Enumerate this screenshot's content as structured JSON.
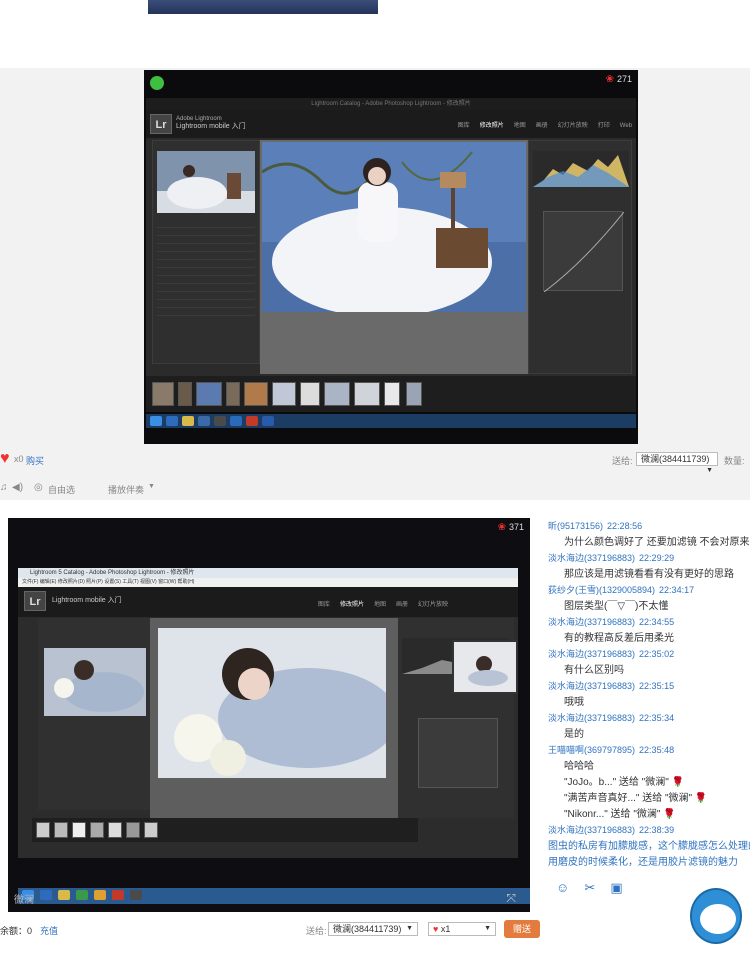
{
  "screen1": {
    "viewer_count": "271",
    "lr_title": "Lightroom Catalog - Adobe Photoshop Lightroom - 修改照片",
    "lr_logo": "Lr",
    "lr_catalog_line1": "Adobe Lightroom",
    "lr_catalog_line2": "Lightroom mobile 入门",
    "modules": [
      "图库",
      "修改照片",
      "地图",
      "画册",
      "幻灯片放映",
      "打印",
      "Web"
    ],
    "active_module": "修改照片",
    "footer": {
      "gift_count": "x0",
      "buy_label": "购买",
      "send_label": "送给:",
      "send_target": "微澜(384411739)",
      "quantity_label": "数量:"
    },
    "controls": {
      "mode_label": "自由选",
      "playlist_label": "播放伴奏"
    }
  },
  "screen2": {
    "viewer_count": "371",
    "lr_title": "Lightroom 5 Catalog - Adobe Photoshop Lightroom - 修改照片",
    "lr_menubar": "文件(F)  编辑(E)  修改照片(D)  照片(P)  设置(S)  工具(T)  视图(V)  窗口(W)  帮助(H)",
    "lr_logo": "Lr",
    "lr_catalog_line2": "Lightroom mobile 入门",
    "modules": [
      "图库",
      "修改照片",
      "地图",
      "画册",
      "幻灯片放映"
    ],
    "active_module": "修改照片",
    "watermark": "微澜",
    "footer": {
      "balance_label": "余额：0",
      "recharge_label": "充值",
      "send_label": "送给:",
      "send_target": "微澜(384411739)",
      "gift_count": "x1",
      "send_button": "赠送"
    }
  },
  "chat": [
    {
      "type": "header",
      "name": "昕(95173156)",
      "time": "22:28:56"
    },
    {
      "type": "msg",
      "text": "为什么颜色调好了   还要加滤镜     不会对原来的调色影响吗"
    },
    {
      "type": "header",
      "name": "淡水海边(337196883)",
      "time": "22:29:29"
    },
    {
      "type": "msg",
      "text": "那应该是用滤镜看看有没有更好的思路"
    },
    {
      "type": "header",
      "name": "荻纱夕(王雪)(1329005894)",
      "time": "22:34:17"
    },
    {
      "type": "msg",
      "text": "图层类型(￣▽￣)不太懂"
    },
    {
      "type": "header",
      "name": "淡水海边(337196883)",
      "time": "22:34:55"
    },
    {
      "type": "msg",
      "text": "有的教程高反差后用柔光"
    },
    {
      "type": "header",
      "name": "淡水海边(337196883)",
      "time": "22:35:02"
    },
    {
      "type": "msg",
      "text": "有什么区别吗"
    },
    {
      "type": "header",
      "name": "淡水海边(337196883)",
      "time": "22:35:15"
    },
    {
      "type": "msg",
      "text": "哦哦"
    },
    {
      "type": "header",
      "name": "淡水海边(337196883)",
      "time": "22:35:34"
    },
    {
      "type": "msg",
      "text": "是的"
    },
    {
      "type": "header",
      "name": "王喵喵啊(369797895)",
      "time": "22:35:48"
    },
    {
      "type": "msg",
      "text": "哈哈哈"
    },
    {
      "type": "msg",
      "text": "\"JoJo。b...\" 送给 \"微澜\" 🌹"
    },
    {
      "type": "msg",
      "text": "\"满苦声音真好...\" 送给 \"微澜\" 🌹"
    },
    {
      "type": "msg",
      "text": "\"Nikonr...\" 送给 \"微澜\" 🌹"
    },
    {
      "type": "header",
      "name": "淡水海边(337196883)",
      "time": "22:38:39"
    },
    {
      "type": "msg-blue",
      "text": "图虫的私房有加朦胧感，这个朦胧感怎么处理的"
    },
    {
      "type": "msg-blue",
      "text": "用磨皮的时候柔化，还是用胶片滤镜的魅力"
    }
  ],
  "chat_tools": [
    "smile-icon",
    "scissors-icon",
    "image-icon"
  ]
}
